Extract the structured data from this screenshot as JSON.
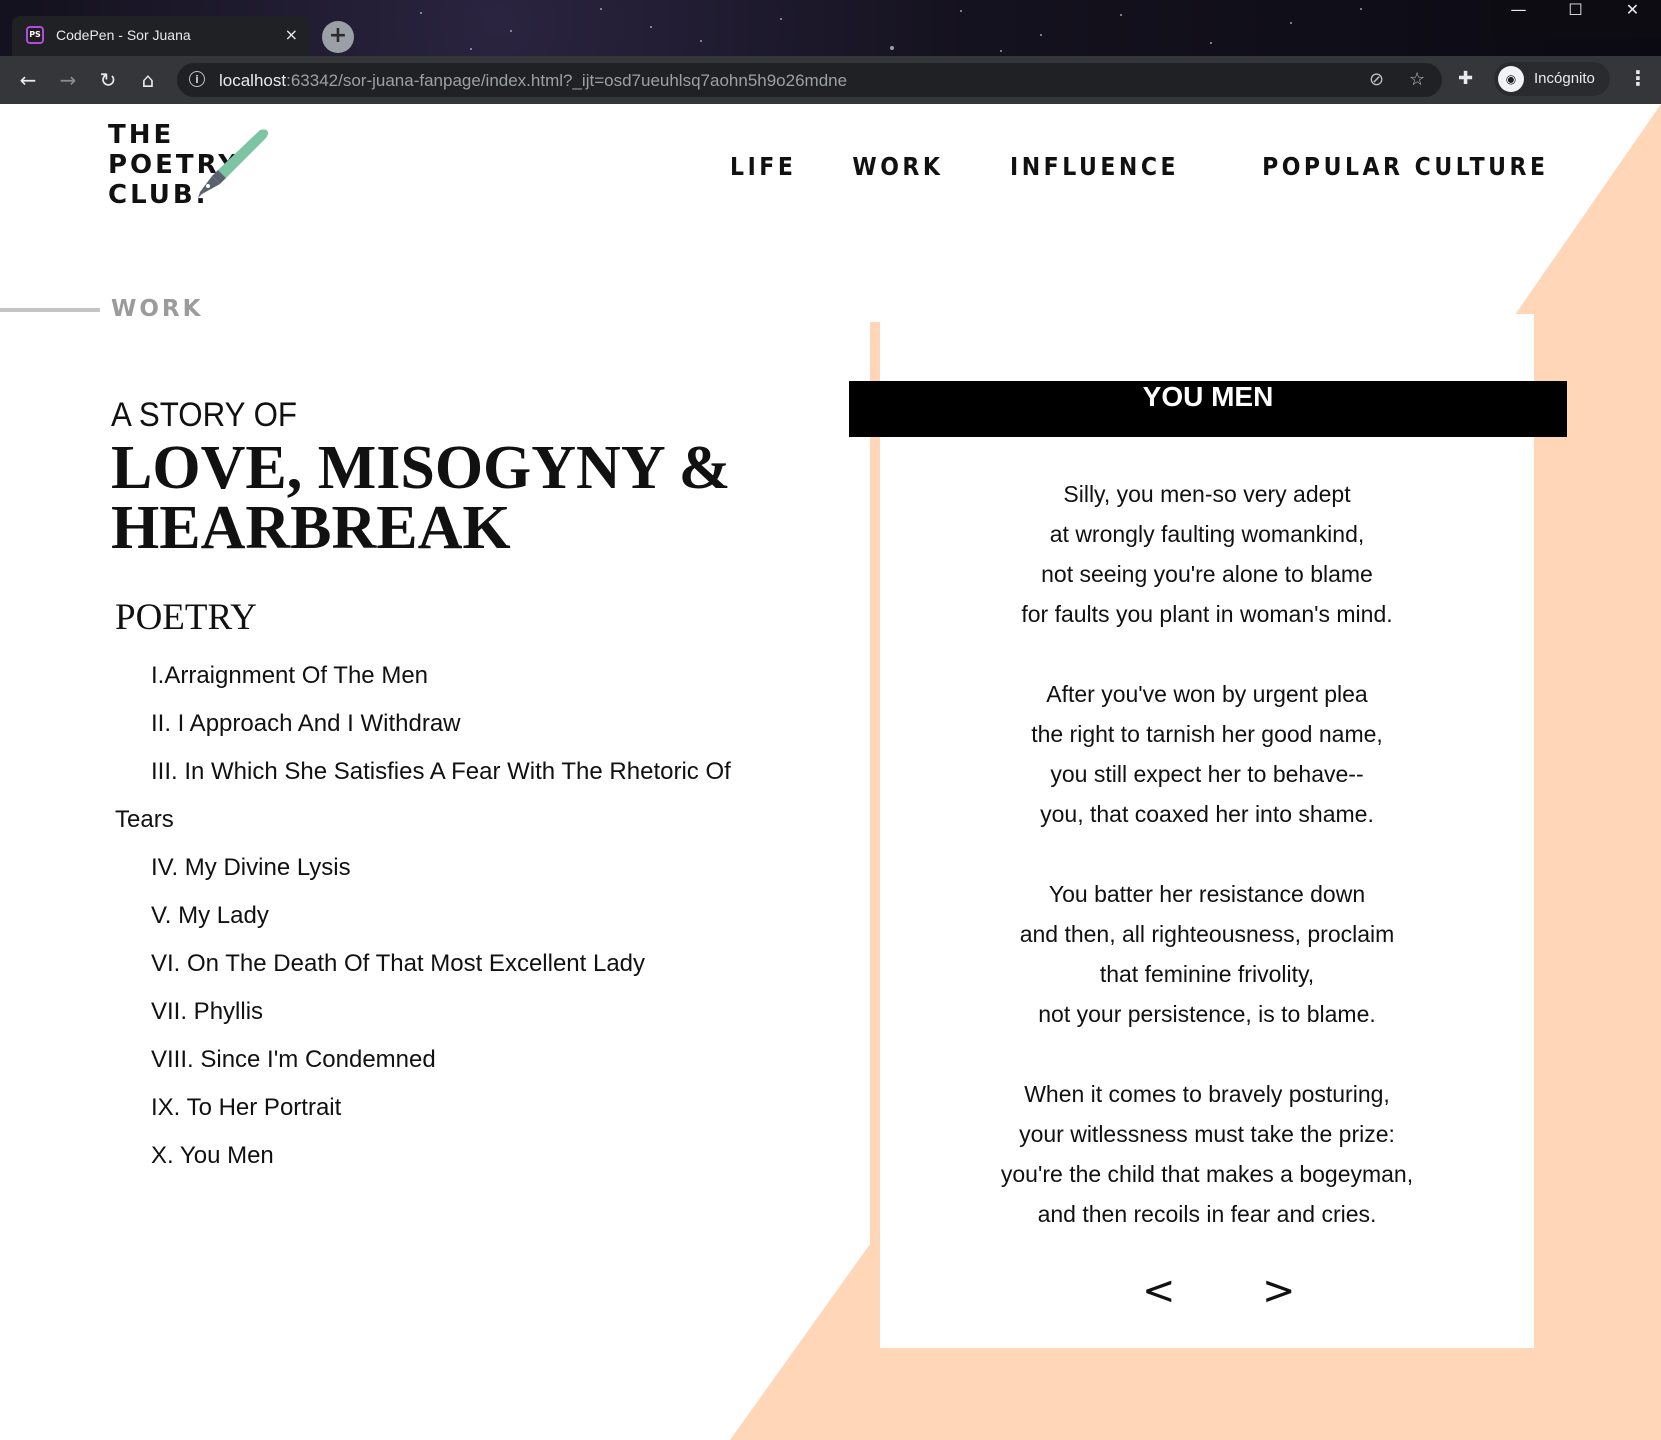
{
  "browser": {
    "tab_title": "CodePen - Sor Juana",
    "tab_close": "×",
    "new_tab": "+",
    "url_host": "localhost",
    "url_rest": ":63342/sor-juana-fanpage/index.html?_ijt=osd7ueuhlsq7aohn5h9o26mdne",
    "profile_label": "Incógnito",
    "window_controls": [
      "—",
      "☐",
      "✕"
    ]
  },
  "logo": {
    "line1": "THE",
    "line2": "POETRY",
    "line3": "CLUB."
  },
  "nav": {
    "items": [
      "LIFE",
      "WORK",
      "INFLUENCE",
      "POPULAR CULTURE"
    ]
  },
  "section": {
    "label": "WORK"
  },
  "intro": {
    "kicker": "A STORY OF",
    "headline": "LOVE, MISOGYNY & HEARBREAK"
  },
  "poetry": {
    "heading": "POETRY",
    "items": [
      "I.Arraignment Of The Men",
      "II. I Approach And I Withdraw",
      "III. In Which She Satisfies A Fear With The Rhetoric Of Tears",
      "IV. My Divine Lysis",
      "V. My Lady",
      "VI. On The Death Of That Most Excellent Lady",
      "VII. Phyllis",
      "VIII. Since I'm Condemned",
      "IX. To Her Portrait",
      "X. You Men"
    ],
    "active_index": 9
  },
  "poem": {
    "title": "YOU MEN",
    "stanzas": [
      [
        "Silly, you men-so very adept",
        "at wrongly faulting womankind,",
        "not seeing you're alone to blame",
        "for faults you plant in woman's mind."
      ],
      [
        "After you've won by urgent plea",
        "the right to tarnish her good name,",
        "you still expect her to behave--",
        "you, that coaxed her into shame."
      ],
      [
        "You batter her resistance down",
        "and then, all righteousness, proclaim",
        "that feminine frivolity,",
        "not your persistence, is to blame."
      ],
      [
        "When it comes to bravely posturing,",
        "your witlessness must take the prize:",
        "you're the child that makes a bogeyman,",
        "and then recoils in fear and cries."
      ]
    ],
    "prev": "<",
    "next": ">"
  },
  "colors": {
    "peach": "#ffd7b8",
    "pen_teal": "#7cc4a4"
  }
}
